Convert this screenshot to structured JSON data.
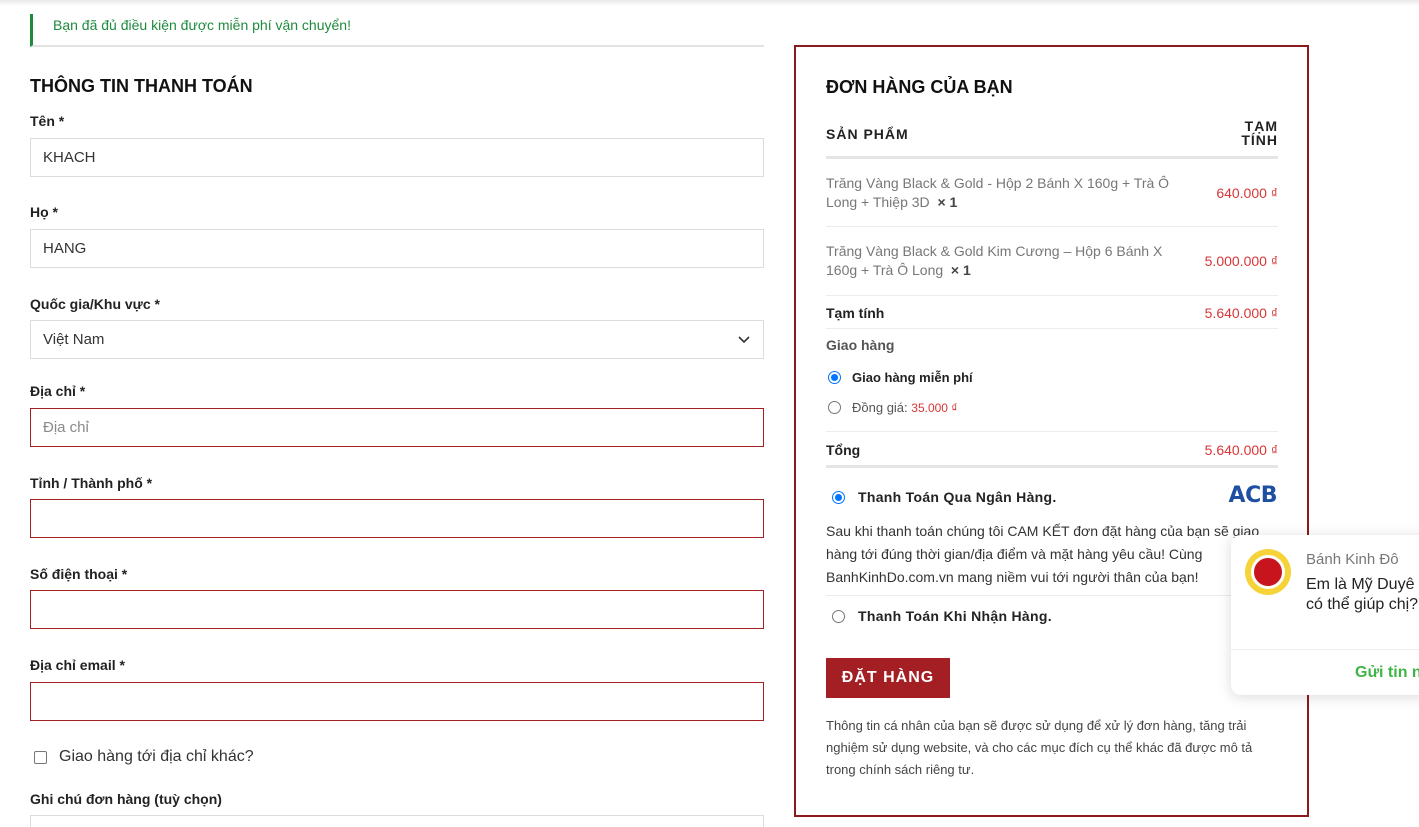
{
  "notice": "Bạn đã đủ điều kiện được miễn phí vận chuyển!",
  "billing": {
    "title": "THÔNG TIN THANH TOÁN",
    "first_name": {
      "label": "Tên *",
      "value": "KHACH"
    },
    "last_name": {
      "label": "Họ *",
      "value": "HANG"
    },
    "country": {
      "label": "Quốc gia/Khu vực *",
      "value": "Việt Nam"
    },
    "address": {
      "label": "Địa chỉ *",
      "placeholder": "Địa chỉ"
    },
    "city": {
      "label": "Tỉnh / Thành phố *",
      "value": ""
    },
    "phone": {
      "label": "Số điện thoại *",
      "value": ""
    },
    "email": {
      "label": "Địa chỉ email *",
      "value": ""
    },
    "ship_other": "Giao hàng tới địa chỉ khác?",
    "notes_label": "Ghi chú đơn hàng (tuỳ chọn)"
  },
  "order": {
    "title": "ĐƠN HÀNG CỦA BẠN",
    "col_product": "SẢN PHẨM",
    "col_subtotal_1": "TẠM",
    "col_subtotal_2": "TÍNH",
    "items": [
      {
        "name": "Trăng Vàng Black & Gold - Hộp 2 Bánh X 160g + Trà Ô Long + Thiệp 3D",
        "qty": "× 1",
        "price": "640.000 ₫"
      },
      {
        "name": "Trăng Vàng Black & Gold Kim Cương – Hộp 6 Bánh X 160g + Trà Ô Long",
        "qty": "× 1",
        "price": "5.000.000 ₫"
      }
    ],
    "subtotal_label": "Tạm tính",
    "subtotal_value": "5.640.000 ₫",
    "shipping_label": "Giao hàng",
    "shipping_free": "Giao hàng miễn phí",
    "shipping_flat_label": "Đồng giá:",
    "shipping_flat_price": "35.000 ₫",
    "total_label": "Tổng",
    "total_value": "5.640.000 ₫",
    "pay_bank": "Thanh Toán Qua Ngân Hàng.",
    "bank_logo": "ACB",
    "pay_bank_desc": "Sau khi thanh toán chúng tôi CAM KẾT đơn đặt hàng của bạn sẽ giao hàng tới đúng thời gian/địa điểm và mặt hàng yêu cầu! Cùng BanhKinhDo.com.vn mang niềm vui tới người thân của bạn!",
    "pay_cod": "Thanh Toán Khi Nhận Hàng.",
    "place_order": "ĐẶT HÀNG",
    "privacy_text": "Thông tin cá nhân của bạn sẽ được sử dụng để xử lý đơn hàng, tăng trải nghiệm sử dụng website, và cho các mục đích cụ thể khác đã được mô tả trong",
    "privacy_link": "chính sách riêng tư."
  },
  "chat": {
    "sender": "Bánh Kinh Đô",
    "message": "Em là Mỹ Duyê Em có thể giúp chị?",
    "send": "Gửi tin n"
  },
  "colors": {
    "accent": "#a31f24",
    "price": "#d63638",
    "success": "#1e8a3e"
  }
}
